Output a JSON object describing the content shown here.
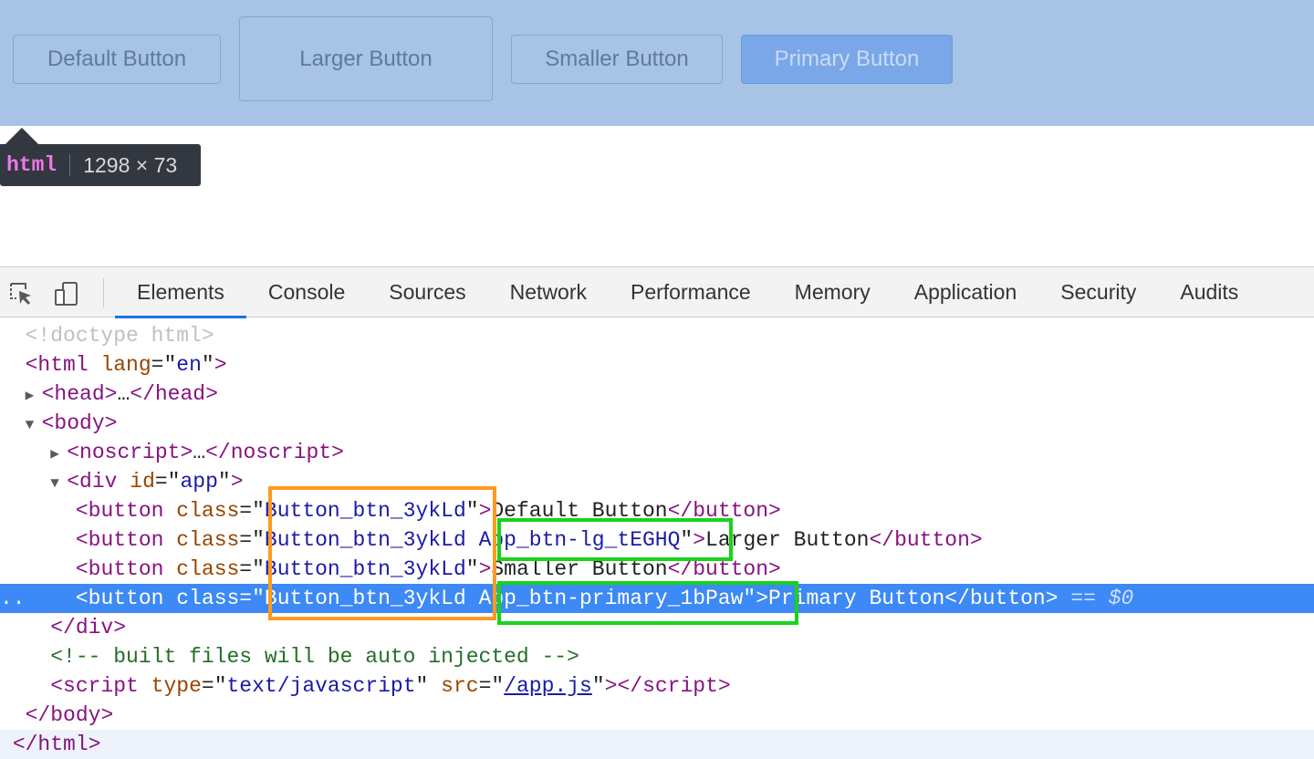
{
  "preview": {
    "buttons": {
      "default": "Default Button",
      "larger": "Larger Button",
      "smaller": "Smaller Button",
      "primary": "Primary Button"
    }
  },
  "tooltip": {
    "tag": "html",
    "dims": "1298 × 73"
  },
  "devtools": {
    "tabs": [
      "Elements",
      "Console",
      "Sources",
      "Network",
      "Performance",
      "Memory",
      "Application",
      "Security",
      "Audits"
    ],
    "tree": {
      "doctype": "<!doctype html>",
      "html_tag": "html",
      "lang_attr": "lang",
      "lang_val": "en",
      "head": "head",
      "body": "body",
      "noscript": "noscript",
      "div": "div",
      "id_attr": "id",
      "id_val": "app",
      "button": "button",
      "class_attr": "class",
      "base_class": "Button_btn_3ykLd",
      "lg_class": "App_btn-lg_tEGHQ",
      "primary_class": "App_btn-primary_1bPaw",
      "labels": [
        "Default Button",
        "Larger Button",
        "Smaller Button",
        "Primary Button"
      ],
      "eq_marker": "== $0",
      "comment": "<!-- built files will be auto injected -->",
      "script": "script",
      "type_attr": "type",
      "type_val": "text/javascript",
      "src_attr": "src",
      "src_val": "/app.js"
    }
  },
  "colors": {
    "preview_bg": "#a7c4e6",
    "primary_btn": "#7aa7e8",
    "selected_row": "#3d89f5",
    "highlight_orange": "#ff9a1f",
    "highlight_green": "#19d21c"
  }
}
